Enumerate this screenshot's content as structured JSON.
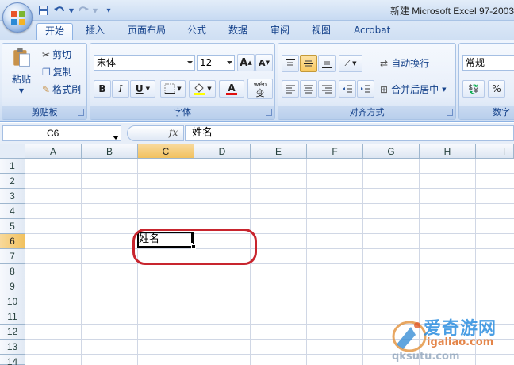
{
  "window": {
    "title": "新建 Microsoft Excel 97-2003"
  },
  "quick_access": {
    "save_icon": "save-icon",
    "undo_icon": "undo-icon",
    "redo_icon": "redo-icon",
    "customize_icon": "customize-qat-icon"
  },
  "tabs": [
    {
      "label": "开始",
      "active": true
    },
    {
      "label": "插入"
    },
    {
      "label": "页面布局"
    },
    {
      "label": "公式"
    },
    {
      "label": "数据"
    },
    {
      "label": "审阅"
    },
    {
      "label": "视图"
    },
    {
      "label": "Acrobat"
    }
  ],
  "ribbon": {
    "clipboard": {
      "label": "剪贴板",
      "paste": "粘贴",
      "cut": "剪切",
      "copy": "复制",
      "format_painter": "格式刷"
    },
    "font": {
      "label": "字体",
      "font_name": "宋体",
      "font_size": "12",
      "bold": "B",
      "italic": "I",
      "underline": "U",
      "grow": "A",
      "shrink": "A",
      "font_color_letter": "A",
      "phonetic": "wén",
      "phonetic_char": "变"
    },
    "alignment": {
      "label": "对齐方式",
      "wrap_text": "自动换行",
      "merge_center": "合并后居中"
    },
    "number": {
      "label": "数字",
      "format": "常规",
      "percent": "%"
    }
  },
  "formula_bar": {
    "name_box": "C6",
    "fx": "fx",
    "content": "姓名"
  },
  "grid": {
    "columns": [
      "A",
      "B",
      "C",
      "D",
      "E",
      "F",
      "G",
      "H",
      "I"
    ],
    "rows": [
      "1",
      "2",
      "3",
      "4",
      "5",
      "6",
      "7",
      "8",
      "9",
      "10",
      "11",
      "12",
      "13",
      "14"
    ],
    "selected_column": "C",
    "selected_row": "6",
    "active_cell_value": "姓名"
  },
  "watermark": {
    "line1": "爱奇游网",
    "line2": "igaliao.com",
    "line3": "qksutu.com"
  },
  "colors": {
    "accent_blue": "#15428b",
    "annotation_red": "#c8252e",
    "selected_header": "#f1c15f"
  }
}
